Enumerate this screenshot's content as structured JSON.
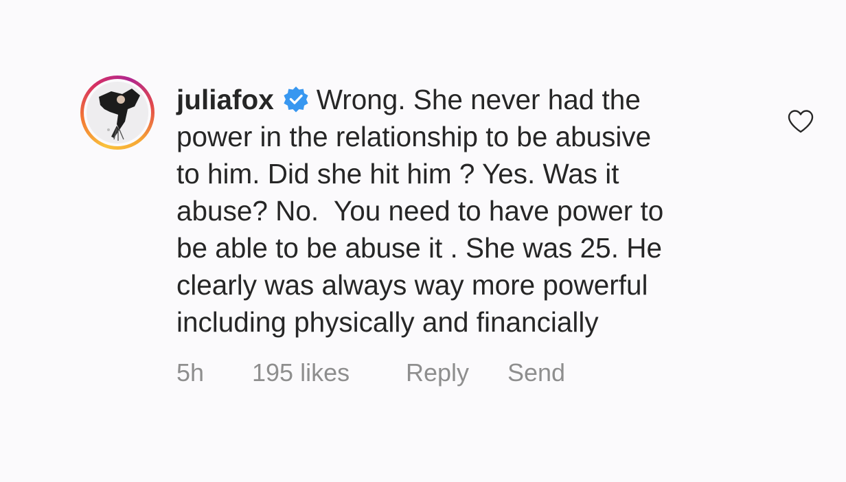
{
  "comment": {
    "username": "juliafox",
    "verified": true,
    "text_lines": [
      "Wrong. She never had the",
      "power in the relationship to be abusive",
      "to him. Did she hit him ? Yes. Was it",
      "abuse? No.  You need to have power to",
      "be able to be abuse it . She was 25. He",
      "clearly was always way more powerful",
      "including physically and financially"
    ],
    "time": "5h",
    "likes": "195 likes",
    "reply_label": "Reply",
    "send_label": "Send"
  },
  "icons": {
    "avatar": "profile-photo",
    "verified": "verified-badge-icon",
    "like": "heart-outline-icon"
  },
  "colors": {
    "text": "#262626",
    "meta": "#8e8e8e",
    "verified": "#3897f0",
    "background": "#fbfafc"
  }
}
